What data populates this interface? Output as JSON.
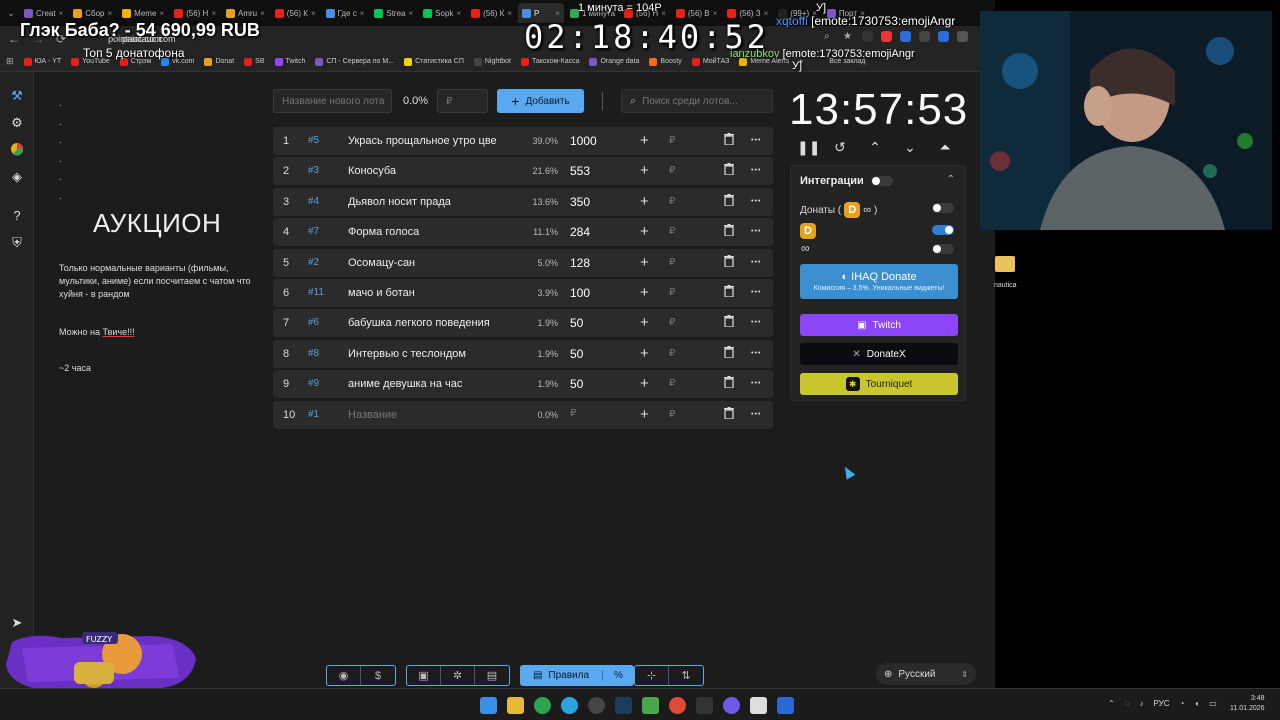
{
  "browser": {
    "tabs": [
      {
        "label": "Creat",
        "color": "#7e57c2"
      },
      {
        "label": "Сбор",
        "color": "#e6a21e"
      },
      {
        "label": "Meme",
        "color": "#f0b400"
      },
      {
        "label": "(56) Н",
        "color": "#e62117"
      },
      {
        "label": "Amru",
        "color": "#e6a21e"
      },
      {
        "label": "(56) К",
        "color": "#e62117"
      },
      {
        "label": "Где с",
        "color": "#4a90e2"
      },
      {
        "label": "Strea",
        "color": "#00c853"
      },
      {
        "label": "Sopk",
        "color": "#00c853"
      },
      {
        "label": "(56) К",
        "color": "#e62117"
      },
      {
        "label": "P",
        "color": "#4a90e2"
      },
      {
        "label": "1 минута",
        "color": "#34a853"
      },
      {
        "label": "(56) Н",
        "color": "#e62117"
      },
      {
        "label": "(56) В",
        "color": "#e62117"
      },
      {
        "label": "(56) З",
        "color": "#e62117"
      },
      {
        "label": "(99+)",
        "color": "#222222"
      },
      {
        "label": "Порт",
        "color": "#7e57c2"
      }
    ],
    "url": "pointauc.com",
    "bookmarks": [
      {
        "label": "ЮА - YT",
        "color": "#e62117"
      },
      {
        "label": "YouTube",
        "color": "#e62117"
      },
      {
        "label": "Стрэм",
        "color": "#e62117"
      },
      {
        "label": "vk.com",
        "color": "#2787f5"
      },
      {
        "label": "Donat",
        "color": "#e6a21e"
      },
      {
        "label": "SB",
        "color": "#e62117"
      },
      {
        "label": "Twitch",
        "color": "#9146ff"
      },
      {
        "label": "СП - Сервера по М...",
        "color": "#7e57c2"
      },
      {
        "label": "Статистика СП",
        "color": "#f0d400"
      },
      {
        "label": "Nightbot",
        "color": "#444444"
      },
      {
        "label": "Такском-Касса",
        "color": "#e62117"
      },
      {
        "label": "Orange data",
        "color": "#7e57c2"
      },
      {
        "label": "Boosty",
        "color": "#f06b20"
      },
      {
        "label": "МойТАЗ",
        "color": "#e62117"
      },
      {
        "label": "Meme Alerts",
        "color": "#f0b400"
      }
    ],
    "all_bookmarks": "Все заклад"
  },
  "overlays": {
    "donation_goal": "Глэк Баба? - 54 690,99 RUB",
    "top_donors": "Топ  5 донатофона",
    "stream_timer": "02:18:40:52",
    "minute_note": "1 минута = 104Р",
    "chat1_nick": "xqtoffi",
    "chat1_msg": "[emote:1730753:emojiAngr",
    "chat1_prefix": "У]",
    "chat2_nick": "ianzubkov",
    "chat2_msg": "[emote:1730753:emojiAngr",
    "chat2_tail": "У]"
  },
  "sidebar": {
    "icons": [
      "gavel-icon",
      "gear-icon",
      "pie-chart-icon",
      "layers-icon",
      "help-icon",
      "shield-icon",
      "telegram-icon"
    ]
  },
  "description": {
    "dots": [
      ".",
      ".",
      ".",
      ".",
      ".",
      "."
    ],
    "title": "АУКЦИОН",
    "text": "Только нормальные варианты (фильмы, мультики, аниме) если посчитаем с чатом что хуйня - в рандом",
    "twitch_prefix": "Можно на ",
    "twitch_link": "Твиче!!!",
    "duration": "~2 часа"
  },
  "controls": {
    "new_lot_placeholder": "Название нового лота",
    "percent": "0.0%",
    "amount_placeholder": "₽",
    "add_label": "Добавить",
    "search_placeholder": "Поиск среди лотов..."
  },
  "lots": [
    {
      "n": "1",
      "id": "#5",
      "name": "Укрась прощальное утро цве",
      "pct": "39.0%",
      "amount": "1000"
    },
    {
      "n": "2",
      "id": "#3",
      "name": "Коносуба",
      "pct": "21.6%",
      "amount": "553"
    },
    {
      "n": "3",
      "id": "#4",
      "name": "Дьявол носит прада",
      "pct": "13.6%",
      "amount": "350"
    },
    {
      "n": "4",
      "id": "#7",
      "name": "Форма голоса",
      "pct": "11.1%",
      "amount": "284"
    },
    {
      "n": "5",
      "id": "#2",
      "name": "Осомацу-сан",
      "pct": "5.0%",
      "amount": "128"
    },
    {
      "n": "6",
      "id": "#11",
      "name": "мачо и ботан",
      "pct": "3.9%",
      "amount": "100"
    },
    {
      "n": "7",
      "id": "#6",
      "name": "бабушка легкого поведения",
      "pct": "1.9%",
      "amount": "50"
    },
    {
      "n": "8",
      "id": "#8",
      "name": "Интервью с теслондом",
      "pct": "1.9%",
      "amount": "50"
    },
    {
      "n": "9",
      "id": "#9",
      "name": "аниме девушка на час",
      "pct": "1.9%",
      "amount": "50"
    },
    {
      "n": "10",
      "id": "#1",
      "name": "Название",
      "pct": "0.0%",
      "amount": "₽",
      "placeholder": true
    }
  ],
  "currency_symbol": "₽",
  "timer": {
    "time": "13:57:53"
  },
  "integrations": {
    "title": "Интеграции",
    "donations_label": "Доnaты (",
    "ihaq_label": "IHAQ Donate",
    "ihaq_sub": "Комиссия – 3,5%. Уникальные виджеты!",
    "twitch_label": "Twitch",
    "donatex_label": "DonateX",
    "tourniquet_label": "Tourniquet",
    "colors": {
      "ihaq": "#3b8fd0",
      "twitch": "#8c45f7",
      "donatex": "#0d0b12",
      "tourniquet": "#c9c62d"
    }
  },
  "bottom": {
    "rules_label": "Правила",
    "rules_pct": "%",
    "language": "Русский"
  },
  "desktop": {
    "icon_label": "nautica"
  },
  "avatar_overlay": {
    "label": "FUZZY"
  },
  "taskbar": {
    "lang": "РУС",
    "time": "3:48",
    "date": "11.01.2026"
  }
}
